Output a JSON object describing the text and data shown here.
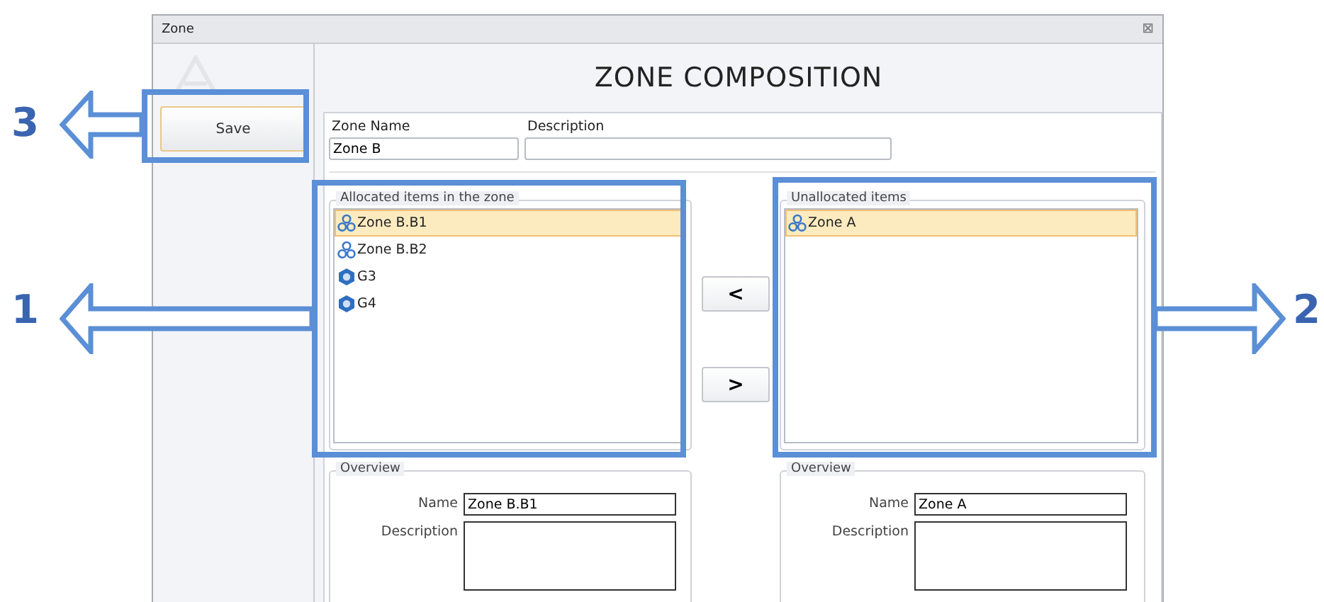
{
  "window": {
    "title": "Zone",
    "close": "⊠"
  },
  "sidebar": {
    "save_button": "Save"
  },
  "heading": "ZONE COMPOSITION",
  "zone_fields": [
    {
      "label": "Zone Name",
      "value": "Zone B"
    },
    {
      "label": "Description"
    }
  ],
  "panels": [
    {
      "legend": "Allocated items in the zone",
      "items": [
        {
          "label": "Zone B.B1",
          "kind": "zone",
          "selected": true
        },
        {
          "label": "Zone B.B2",
          "kind": "zone",
          "selected": false
        },
        {
          "label": "G3",
          "kind": "group",
          "selected": false
        },
        {
          "label": "G4",
          "kind": "group",
          "selected": false
        }
      ],
      "overview": {
        "legend": "Overview",
        "name_label": "Name",
        "name": "Zone B.B1",
        "description_label": "Description"
      }
    },
    {
      "legend": "Unallocated items",
      "items": [
        {
          "label": "Zone A",
          "kind": "zone",
          "selected": true
        }
      ],
      "overview": {
        "legend": "Overview",
        "name_label": "Name",
        "name": "Zone A",
        "description_label": "Description"
      }
    }
  ],
  "move_buttons": [
    "<",
    ">"
  ],
  "annotations": [
    {
      "label": "3",
      "kind": "leftward"
    },
    {
      "label": "1",
      "kind": "leftward"
    },
    {
      "label": "2",
      "kind": "rightward"
    }
  ]
}
